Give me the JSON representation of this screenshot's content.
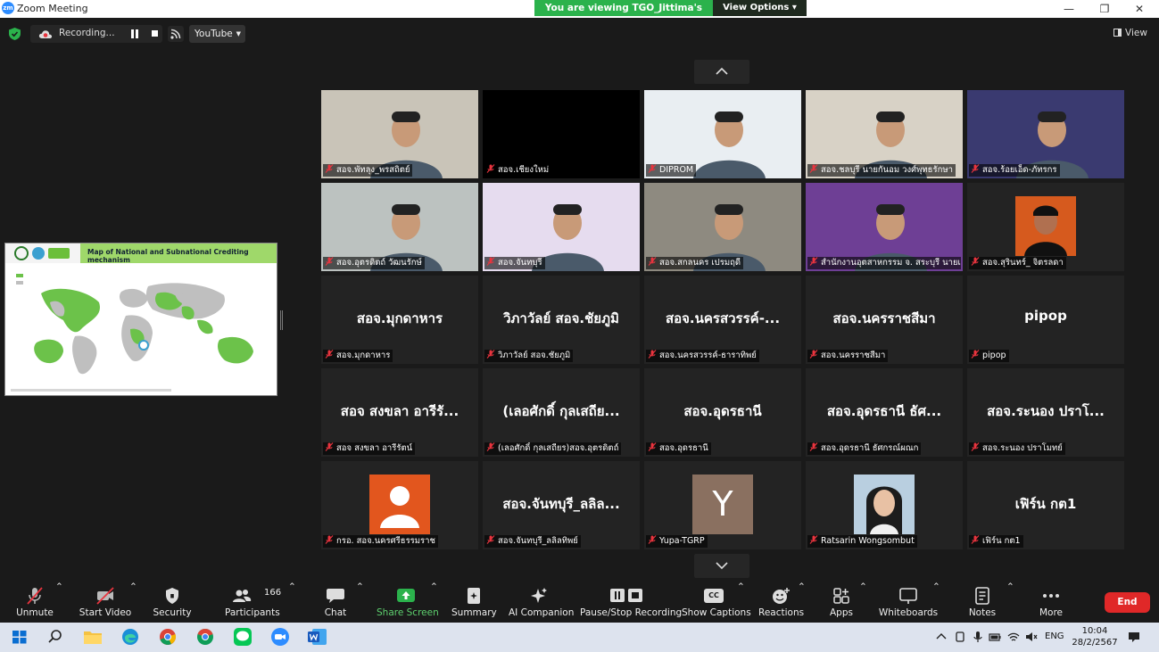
{
  "window": {
    "title": "Zoom Meeting",
    "app_icon": "zm",
    "controls": [
      "minimize-icon",
      "restore-icon",
      "close-icon"
    ]
  },
  "share_banner": {
    "message": "You are viewing TGO_Jittima's screen",
    "options_label": "View Options",
    "options_caret": "▾"
  },
  "top_bar": {
    "recording_label": "Recording...",
    "stream_target": "YouTube",
    "view_label": "View"
  },
  "shared_screen": {
    "slide_title": "Map of National and Subnational Crediting mechanism"
  },
  "participants_grid": [
    {
      "label": "สอจ.พัทลุง_พรสถิตย์",
      "kind": "video",
      "bg": "#c9c4b8"
    },
    {
      "label": "สอจ.เชียงใหม่",
      "kind": "black",
      "bg": "#000000"
    },
    {
      "label": "DIPROM",
      "kind": "video",
      "bg": "#e9eef2"
    },
    {
      "label": "สอจ.ชลบุรี นายกันอม วงศ์พุทธรักษา",
      "kind": "video",
      "bg": "#d8d2c6"
    },
    {
      "label": "สอจ.ร้อยเอ็ด-ภัทรกร",
      "kind": "video",
      "bg": "#3a3a70"
    },
    {
      "label": "สอจ.อุตรดิตถ์ วัฒนรักษ์",
      "kind": "video",
      "bg": "#bcc2c0"
    },
    {
      "label": "สอจ.จันทบุรี",
      "kind": "video",
      "bg": "#e6dcef"
    },
    {
      "label": "สอจ.สกลนคร เปรมฤดี",
      "kind": "video",
      "bg": "#8e8a80"
    },
    {
      "label": "สำนักงานอุตสาหกรรม จ. สระบุรี นายเพชร",
      "kind": "video",
      "bg": "#6e3f95"
    },
    {
      "label": "สอจ.สุรินทร์_ จิตรลดา",
      "kind": "photo",
      "bg": "#232323"
    },
    {
      "label": "สอจ.มุกดาหาร",
      "kind": "name",
      "display": "สอจ.มุกดาหาร"
    },
    {
      "label": "วิภาวัลย์ สอจ.ชัยภูมิ",
      "kind": "name",
      "display": "วิภาวัลย์ สอจ.ชัยภูมิ"
    },
    {
      "label": "สอจ.นครสวรรค์-ธาราทิพย์",
      "kind": "name",
      "display": "สอจ.นครสวรรค์-..."
    },
    {
      "label": "สอจ.นครราชสีมา",
      "kind": "name",
      "display": "สอจ.นครราชสีมา"
    },
    {
      "label": "pipop",
      "kind": "name",
      "display": "pipop"
    },
    {
      "label": "สอจ สงขลา อารีรัตน์",
      "kind": "name",
      "display": "สอจ สงขลา อารีรั..."
    },
    {
      "label": "(เลอศักดิ์ กุลเสถียร)สอจ.อุตรดิตถ์",
      "kind": "name",
      "display": "(เลอศักดิ์ กุลเสถีย..."
    },
    {
      "label": "สอจ.อุดรธานี",
      "kind": "name",
      "display": "สอจ.อุดรธานี"
    },
    {
      "label": "สอจ.อุดรธานี ธัศกรณ์ผณก",
      "kind": "name",
      "display": "สอจ.อุดรธานี ธัศ..."
    },
    {
      "label": "สอจ.ระนอง ปราโมทย์",
      "kind": "name",
      "display": "สอจ.ระนอง ปราโ..."
    },
    {
      "label": "กรอ. สอจ.นครศรีธรรมราช",
      "kind": "default-avatar"
    },
    {
      "label": "สอจ.จันทบุรี_ลลิลทิพย์",
      "kind": "name",
      "display": "สอจ.จันทบุรี_ลลิล..."
    },
    {
      "label": "Yupa-TGRP",
      "kind": "letter",
      "letter": "Y"
    },
    {
      "label": "Ratsarin Wongsombut",
      "kind": "photo2"
    },
    {
      "label": "เฟิร์น กต1",
      "kind": "name",
      "display": "เฟิร์น กต1"
    }
  ],
  "toolbar": {
    "unmute": "Unmute",
    "start_video": "Start Video",
    "security": "Security",
    "participants": "Participants",
    "participants_count": "166",
    "chat": "Chat",
    "share_screen": "Share Screen",
    "summary": "Summary",
    "ai_companion": "AI Companion",
    "pause_stop_recording": "Pause/Stop Recording",
    "show_captions": "Show Captions",
    "captions_badge": "CC",
    "reactions": "Reactions",
    "apps": "Apps",
    "whiteboards": "Whiteboards",
    "notes": "Notes",
    "more": "More",
    "end": "End"
  },
  "taskbar": {
    "language": "ENG",
    "time": "10:04",
    "date": "28/2/2567"
  },
  "colors": {
    "accent_green": "#2bb24c",
    "end_red": "#e02828",
    "muted_red": "#e8343e"
  }
}
